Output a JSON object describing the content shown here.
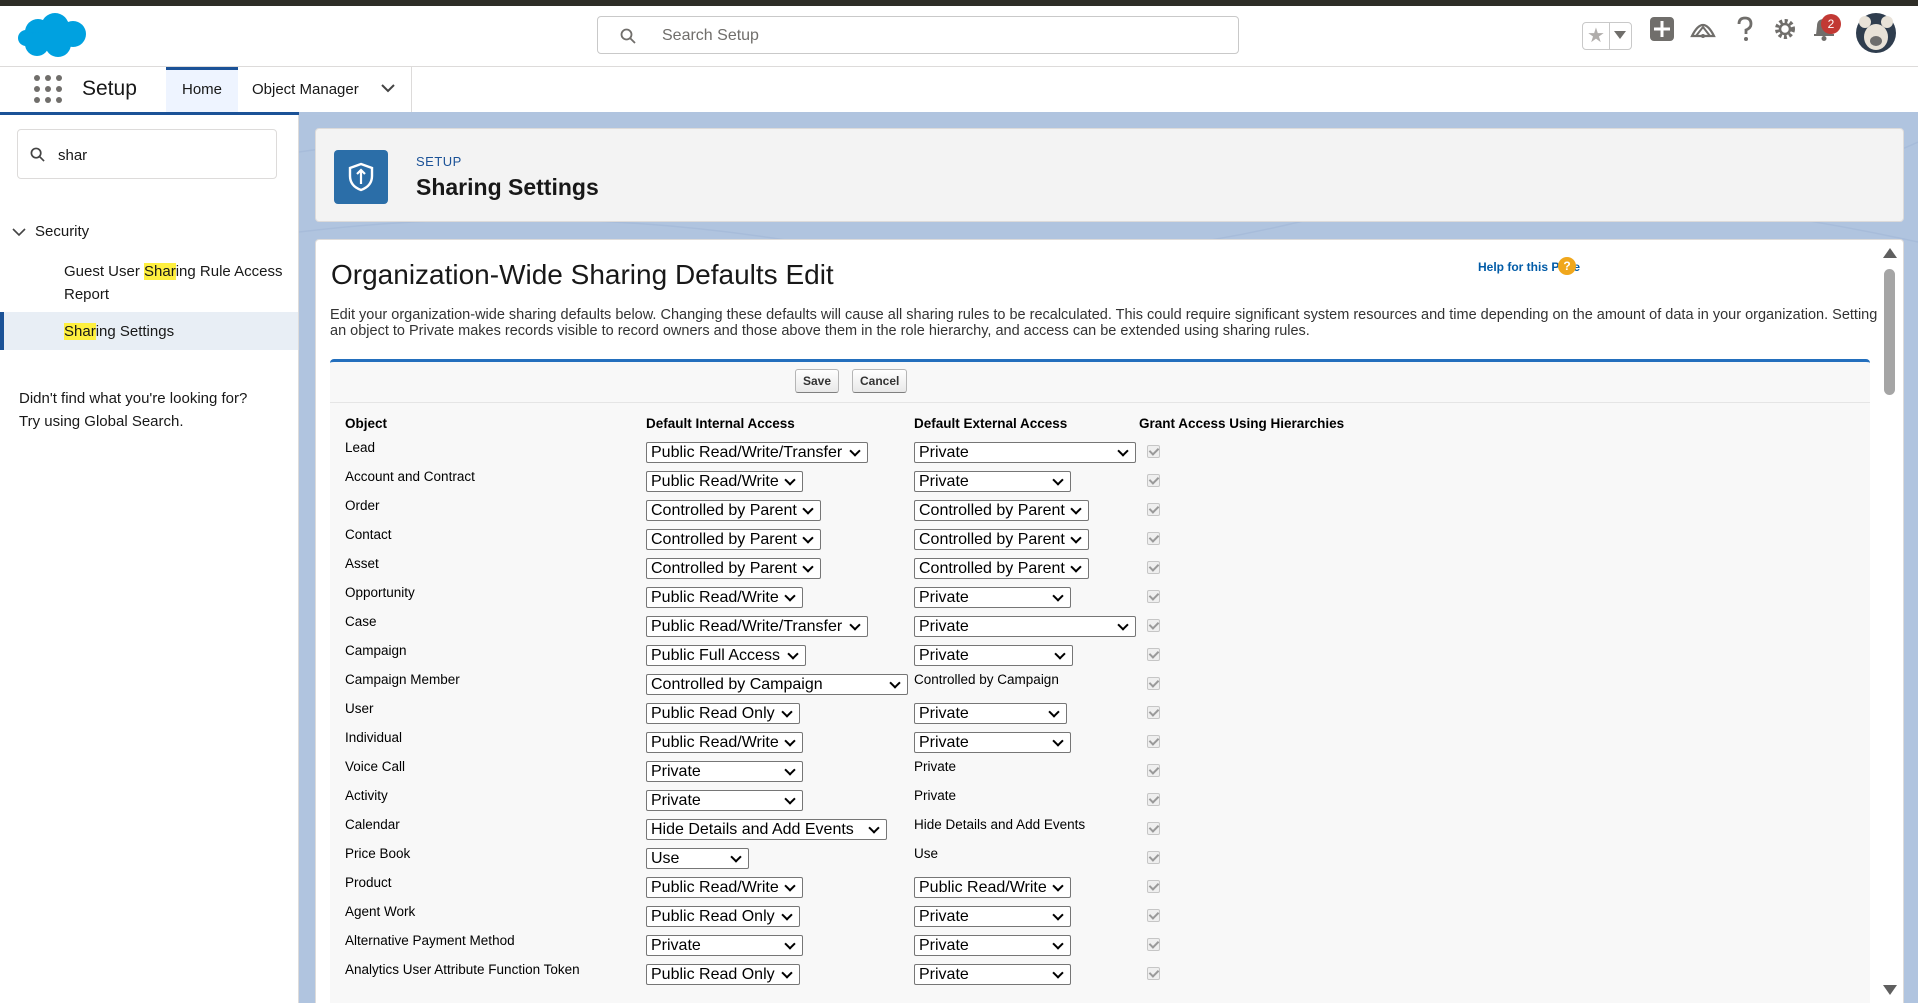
{
  "header": {
    "search_placeholder": "Search Setup",
    "notification_count": "2"
  },
  "nav": {
    "app_name": "Setup",
    "tabs": [
      {
        "label": "Home"
      },
      {
        "label": "Object Manager"
      }
    ]
  },
  "sidebar": {
    "quick_find_value": "shar",
    "section": "Security",
    "items": [
      {
        "pre": "Guest User ",
        "match": "Shar",
        "post": "ing Rule Access Report"
      },
      {
        "pre": "",
        "match": "Shar",
        "post": "ing Settings"
      }
    ],
    "not_found_line1": "Didn't find what you're looking for?",
    "not_found_line2": "Try using Global Search."
  },
  "page_header": {
    "eyebrow": "SETUP",
    "title": "Sharing Settings"
  },
  "content": {
    "title": "Organization-Wide Sharing Defaults Edit",
    "help_link": "Help for this Page",
    "description": "Edit your organization-wide sharing defaults below. Changing these defaults will cause all sharing rules to be recalculated. This could require significant system resources and time depending on the amount of data in your organization. Setting an object to Private makes records visible to record owners and those above them in the role hierarchy, and access can be extended using sharing rules.",
    "save_label": "Save",
    "cancel_label": "Cancel",
    "columns": [
      "Object",
      "Default Internal Access",
      "Default External Access",
      "Grant Access Using Hierarchies"
    ],
    "rows": [
      {
        "object": "Lead",
        "internal": "Public Read/Write/Transfer",
        "external": "Private",
        "external_is_select": true
      },
      {
        "object": "Account and Contract",
        "internal": "Public Read/Write",
        "external": "Private",
        "external_is_select": true
      },
      {
        "object": "Order",
        "internal": "Controlled by Parent",
        "external": "Controlled by Parent",
        "external_is_select": true
      },
      {
        "object": "Contact",
        "internal": "Controlled by Parent",
        "external": "Controlled by Parent",
        "external_is_select": true
      },
      {
        "object": "Asset",
        "internal": "Controlled by Parent",
        "external": "Controlled by Parent",
        "external_is_select": true
      },
      {
        "object": "Opportunity",
        "internal": "Public Read/Write",
        "external": "Private",
        "external_is_select": true
      },
      {
        "object": "Case",
        "internal": "Public Read/Write/Transfer",
        "external": "Private",
        "external_is_select": true
      },
      {
        "object": "Campaign",
        "internal": "Public Full Access",
        "external": "Private",
        "external_is_select": true
      },
      {
        "object": "Campaign Member",
        "internal": "Controlled by Campaign",
        "external": "Controlled by Campaign",
        "external_is_select": false
      },
      {
        "object": "User",
        "internal": "Public Read Only",
        "external": "Private",
        "external_is_select": true
      },
      {
        "object": "Individual",
        "internal": "Public Read/Write",
        "external": "Private",
        "external_is_select": true
      },
      {
        "object": "Voice Call",
        "internal": "Private",
        "external": "Private",
        "external_is_select": false
      },
      {
        "object": "Activity",
        "internal": "Private",
        "external": "Private",
        "external_is_select": false
      },
      {
        "object": "Calendar",
        "internal": "Hide Details and Add Events",
        "external": "Hide Details and Add Events",
        "external_is_select": false
      },
      {
        "object": "Price Book",
        "internal": "Use",
        "external": "Use",
        "external_is_select": false
      },
      {
        "object": "Product",
        "internal": "Public Read/Write",
        "external": "Public Read/Write",
        "external_is_select": true
      },
      {
        "object": "Agent Work",
        "internal": "Public Read Only",
        "external": "Private",
        "external_is_select": true
      },
      {
        "object": "Alternative Payment Method",
        "internal": "Private",
        "external": "Private",
        "external_is_select": true
      },
      {
        "object": "Analytics User Attribute Function Token",
        "internal": "Public Read Only",
        "external": "Private",
        "external_is_select": true
      }
    ]
  },
  "colors": {
    "brand_blue": "#1b5297",
    "salesforce_cloud": "#00a1e0",
    "notification_red": "#c23934",
    "background_blue": "#b0c4df"
  }
}
